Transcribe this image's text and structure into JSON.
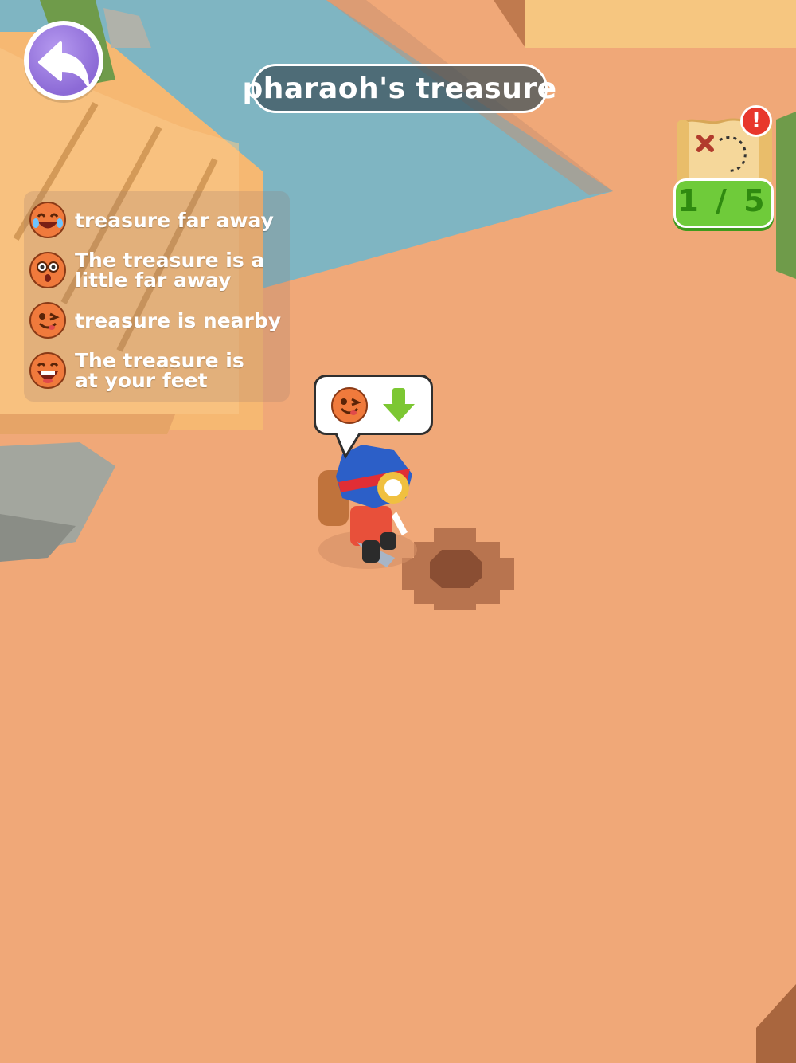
{
  "title": "pharaoh's treasure",
  "back_button": {
    "icon": "back-arrow-icon",
    "color": "#8c6ad6"
  },
  "treasure_map": {
    "icon": "treasure-map-icon",
    "alert_icon": "exclamation-icon",
    "alert_text": "!",
    "progress": "1 / 5",
    "found": 1,
    "total": 5
  },
  "legend": [
    {
      "label_lines": [
        "treasure far away"
      ],
      "icon": "crying-laughing-face-icon"
    },
    {
      "label_lines": [
        "The treasure is a",
        "little far away"
      ],
      "icon": "surprised-face-icon"
    },
    {
      "label_lines": [
        "treasure is nearby"
      ],
      "icon": "winking-face-icon"
    },
    {
      "label_lines": [
        "The treasure is",
        "at your feet"
      ],
      "icon": "laughing-face-icon"
    }
  ],
  "hint_bubble": {
    "face_icon": "winking-face-icon",
    "arrow_icon": "down-arrow-icon",
    "arrow_color": "#7cc732"
  },
  "colors": {
    "sand": "#f0a878",
    "water": "#7fb5c2",
    "pyramid": "#f7c27a",
    "rock": "#a7a9a2",
    "dig_hole": "#b8744f"
  }
}
